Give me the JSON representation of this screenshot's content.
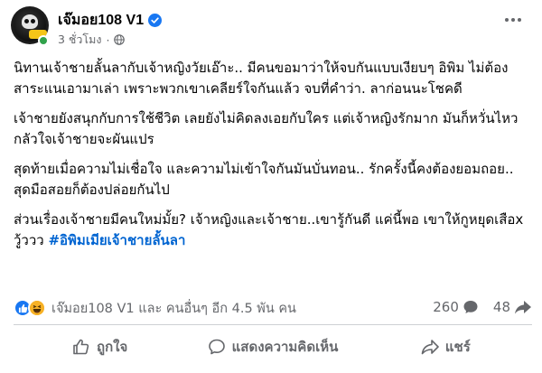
{
  "post": {
    "author": "เจ๊มอย108 V1",
    "timestamp": "3 ชั่วโมง",
    "separator": "·",
    "body": {
      "p1": "นิทานเจ้าชายลั้นลากับเจ้าหญิงวัยเอ๊าะ.. มีคนขอมาว่าให้จบกันแบบเงียบๆ อิพิม ไม่ต้องสาระแนเอามาเล่า เพราะพวกเขาเคลียร์ใจกันแล้ว จบที่คำว่า. ลาก่อนนะโชคดี",
      "p2": "เจ้าชายยังสนุกกับการใช้ชีวิต เลยยังไม่คิดลงเอยกับใคร แต่เจ้าหญิงรักมาก มันก็หวั่นไหว กลัวใจเจ้าชายจะผันแปร",
      "p3": "สุดท้ายเมื่อความไม่เชื่อใจ และความไม่เข้าใจกันมันบั่นทอน.. รักครั้งนี้คงต้องยอมถอย.. สุดมือสอยก็ต้องปล่อยกันไป",
      "p4_text": "ส่วนเรื่องเจ้าชายมีคนใหม่มั้ย? เจ้าหญิงและเจ้าชาย..เขารู้กันดี แค่นี้พอ เขาให้กูหยุดเสือx วู้ววว ",
      "p4_hashtag": "#อิพิมเมียเจ้าชายลั้นลา"
    }
  },
  "reactions": {
    "summary": "เจ๊มอย108 V1 และ คนอื่นๆ อีก 4.5 พัน คน",
    "comments_count": "260",
    "shares_count": "48",
    "types": [
      "like",
      "haha"
    ]
  },
  "actions": {
    "like_label": "ถูกใจ",
    "comment_label": "แสดงความคิดเห็น",
    "share_label": "แชร์"
  },
  "colors": {
    "accent": "#1877f2",
    "hashtag": "#0064d1",
    "secondary_text": "#65676b",
    "online": "#31a24c"
  }
}
